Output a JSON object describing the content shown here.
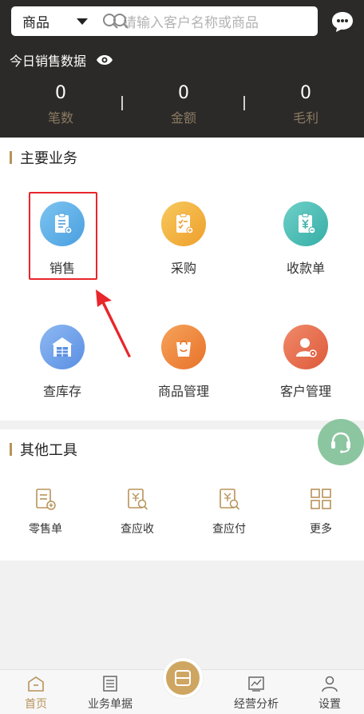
{
  "header": {
    "search": {
      "type_label": "商品",
      "placeholder": "请输入客户名称或商品"
    },
    "today_label": "今日销售数据",
    "stats": [
      {
        "value": "0",
        "label": "笔数"
      },
      {
        "value": "0",
        "label": "金额"
      },
      {
        "value": "0",
        "label": "毛利"
      }
    ]
  },
  "main_business": {
    "title": "主要业务",
    "items": [
      {
        "label": "销售",
        "icon": "clipboard-list-icon",
        "color": "#5aaee6"
      },
      {
        "label": "采购",
        "icon": "clipboard-check-icon",
        "color": "#f0b040"
      },
      {
        "label": "收款单",
        "icon": "yen-receipt-icon",
        "color": "#4dbfb9"
      },
      {
        "label": "查库存",
        "icon": "warehouse-icon",
        "color": "#6a9de8"
      },
      {
        "label": "商品管理",
        "icon": "shopping-bag-icon",
        "color": "#ef8a3c"
      },
      {
        "label": "客户管理",
        "icon": "customer-icon",
        "color": "#e8694a"
      }
    ]
  },
  "other_tools": {
    "title": "其他工具",
    "items": [
      {
        "label": "零售单",
        "icon": "retail-doc-icon"
      },
      {
        "label": "查应收",
        "icon": "receivable-search-icon"
      },
      {
        "label": "查应付",
        "icon": "payable-search-icon"
      },
      {
        "label": "更多",
        "icon": "grid-more-icon"
      }
    ]
  },
  "bottom_nav": {
    "items": [
      {
        "label": "首页",
        "icon": "home-icon",
        "active": true
      },
      {
        "label": "业务单据",
        "icon": "document-icon"
      },
      {
        "label": "经营分析",
        "icon": "chart-icon"
      },
      {
        "label": "设置",
        "icon": "user-settings-icon"
      }
    ]
  },
  "colors": {
    "accent": "#b8935a",
    "highlight": "#e8262b",
    "header_bg": "#2b2a28"
  }
}
